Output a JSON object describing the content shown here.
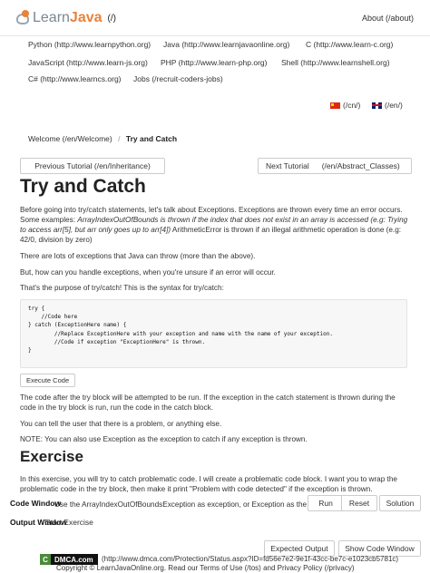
{
  "header": {
    "logo_learn": "Learn",
    "logo_java": "Java",
    "logo_link": "(/)",
    "about": "About (/about)"
  },
  "nav": {
    "row1": [
      "Python (http://www.learnpython.org)",
      "Java (http://www.learnjavaonline.org)",
      "C (http://www.learn-c.org)"
    ],
    "row2": [
      "JavaScript (http://www.learn-js.org)",
      "PHP (http://www.learn-php.org)",
      "Shell (http://www.learnshell.org)"
    ],
    "row3": [
      "C# (http://www.learncs.org)",
      "Jobs (/recruit-coders-jobs)"
    ]
  },
  "languages": {
    "cn": "(/cn/)",
    "en": "(/en/)"
  },
  "breadcrumb": {
    "home": "Welcome (/en/Welcome)",
    "sep": "/",
    "current": "Try and Catch"
  },
  "tutorial_nav": {
    "previous": "Previous Tutorial (/en/Inheritance)",
    "next": "Next Tutorial",
    "next_link": "(/en/Abstract_Classes)"
  },
  "article": {
    "title": "Try and Catch",
    "p1_a": "Before going into try/catch statements, let's talk about Exceptions. Exceptions are thrown every time an error occurs. Some examples: ",
    "p1_b": "ArrayIndexOutOfBounds is thrown if the index that does not exist in an array is accessed (e.g: Trying to access arr[5], but arr only goes up to arr[4])",
    "p1_c": " ArithmeticError is thrown if an illegal arithmetic operation is done (e.g: 42/0, division by zero)",
    "p2": "There are lots of exceptions that Java can throw (more than the above).",
    "p3": "But, how can you handle exceptions, when you're unsure if an error will occur.",
    "p4": "That's the purpose of try/catch! This is the syntax for try/catch:",
    "code": [
      "try {",
      "    //Code here",
      "} catch (ExceptionHere name) {",
      "        //Replace ExceptionHere with your exception and name with the name of your exception.",
      "        //Code if exception \"ExceptionHere\" is thrown.",
      "}"
    ],
    "execute_label": "Execute Code",
    "p5": "The code after the try block will be attempted to be run. If the exception in the catch statement is thrown during the code in the try block is run, run the code in the catch block.",
    "p6": "You can tell the user that there is a problem, or anything else.",
    "p7": "NOTE: You can also use Exception as the exception to catch if any exception is thrown.",
    "exercise_title": "Exercise",
    "p8": "In this exercise, you will try to catch problematic code. I will create a problematic code block. I want you to wrap the problematic code in the try block, then make it print \"Problem with code detected\" if the exception is thrown.",
    "p9": "Use the ArrayIndexOutOfBoundsException as exception, or Exception as the exception."
  },
  "bottom": {
    "code_window": "Code Window",
    "output_window": "Output Window",
    "start_exercise": "Start Exercise",
    "run": "Run",
    "reset": "Reset",
    "solution": "Solution",
    "expected_output": "Expected Output",
    "show_code_window": "Show Code Window"
  },
  "footer": {
    "dmca_icon": "C",
    "dmca_text": "DMCA.com",
    "status": "(http://www.dmca.com/Protection/Status.aspx?ID=fd56e7e2-9e1f-43cc-be7c-e1023cb5781c)",
    "copyright": "Copyright © LearnJavaOnline.org. Read our Terms of Use (/tos) and Privacy Policy (/privacy)"
  }
}
